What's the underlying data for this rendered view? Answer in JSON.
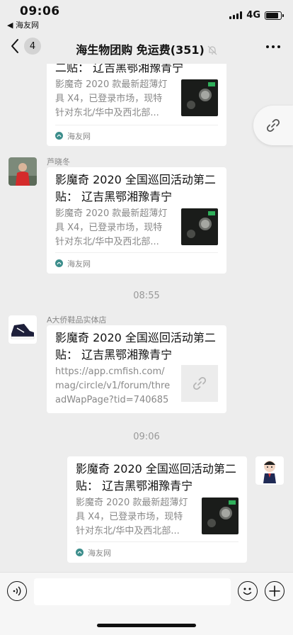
{
  "status_bar": {
    "time": "09:06",
    "back_app": "◀ 海友网",
    "network": "4G",
    "battery_level": 0.85
  },
  "nav": {
    "unread_badge": "4",
    "title": "海生物团购 免运费(351)",
    "muted": true
  },
  "chat": {
    "messages": [
      {
        "sender": "",
        "title": "二贴： 辽吉黑鄂湘豫青宁",
        "desc": "影魔奇 2020 款最新超薄灯具 X4，已登录市场，现特针对东北/华中及西北部...",
        "source": "海友网"
      },
      {
        "sender": "芦晓冬",
        "title": "影魔奇 2020 全国巡回活动第二贴： 辽吉黑鄂湘豫青宁",
        "desc": "影魔奇 2020 款最新超薄灯具 X4，已登录市场，现特针对东北/华中及西北部...",
        "source": "海友网"
      },
      {
        "sender": "A大侨鞋品实体店",
        "title": "影魔奇 2020 全国巡回活动第二贴： 辽吉黑鄂湘豫青宁",
        "desc": "https://app.cmfish.com/mag/circle/v1/forum/threadWapPage?tid=740685&..."
      },
      {
        "sender": "",
        "title": "影魔奇 2020 全国巡回活动第二贴： 辽吉黑鄂湘豫青宁",
        "desc": "影魔奇 2020 款最新超薄灯具 X4，已登录市场，现特针对东北/华中及西北部...",
        "source": "海友网"
      }
    ],
    "timestamps": [
      "08:55",
      "09:06"
    ]
  },
  "input_bar": {
    "text_value": "",
    "placeholder": ""
  },
  "icons": {
    "back": "chevron-left-icon",
    "mute": "bell-off-icon",
    "more": "more-dots-icon",
    "float_link": "link-icon",
    "voice": "voice-icon",
    "emoji": "emoji-icon",
    "plus": "plus-icon",
    "source": "haiyou-logo-icon"
  },
  "colors": {
    "background": "#ededed",
    "bubble": "#ffffff",
    "secondary_text": "#888888",
    "source_logo": "#3d8e8c"
  }
}
